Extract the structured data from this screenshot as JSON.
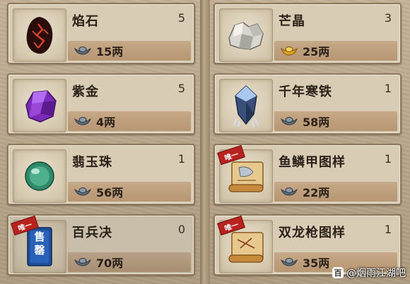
{
  "items": [
    {
      "name": "焰石",
      "qty": "5",
      "price": "15两",
      "icon": "flame-stone-icon",
      "dim": false
    },
    {
      "name": "芒晶",
      "qty": "3",
      "price": "25两",
      "icon": "crystal-ore-icon",
      "dim": false,
      "currency": "gold-ingot-icon"
    },
    {
      "name": "紫金",
      "qty": "5",
      "price": "4两",
      "icon": "purple-gold-icon",
      "dim": false
    },
    {
      "name": "千年寒铁",
      "qty": "1",
      "price": "58两",
      "icon": "cold-iron-icon",
      "dim": false
    },
    {
      "name": "翡玉珠",
      "qty": "1",
      "price": "56两",
      "icon": "jade-pearl-icon",
      "dim": false
    },
    {
      "name": "鱼鳞甲图样",
      "qty": "1",
      "price": "22两",
      "icon": "scroll-pattern-icon",
      "dim": false,
      "badge": "唯一"
    },
    {
      "name": "百兵决",
      "qty": "0",
      "price": "70两",
      "icon": "manual-book-icon",
      "dim": true,
      "badge": "唯一",
      "book_text": "售罄"
    },
    {
      "name": "双龙枪图样",
      "qty": "1",
      "price": "35两",
      "icon": "scroll-pattern-icon",
      "dim": false,
      "badge": "唯一"
    }
  ],
  "watermark": {
    "text": "@烟雨江湖吧",
    "logo": "百"
  },
  "colors": {
    "card_bg": "#d9ccb4",
    "price_band": "#c0a07d",
    "text": "#2b2119"
  }
}
